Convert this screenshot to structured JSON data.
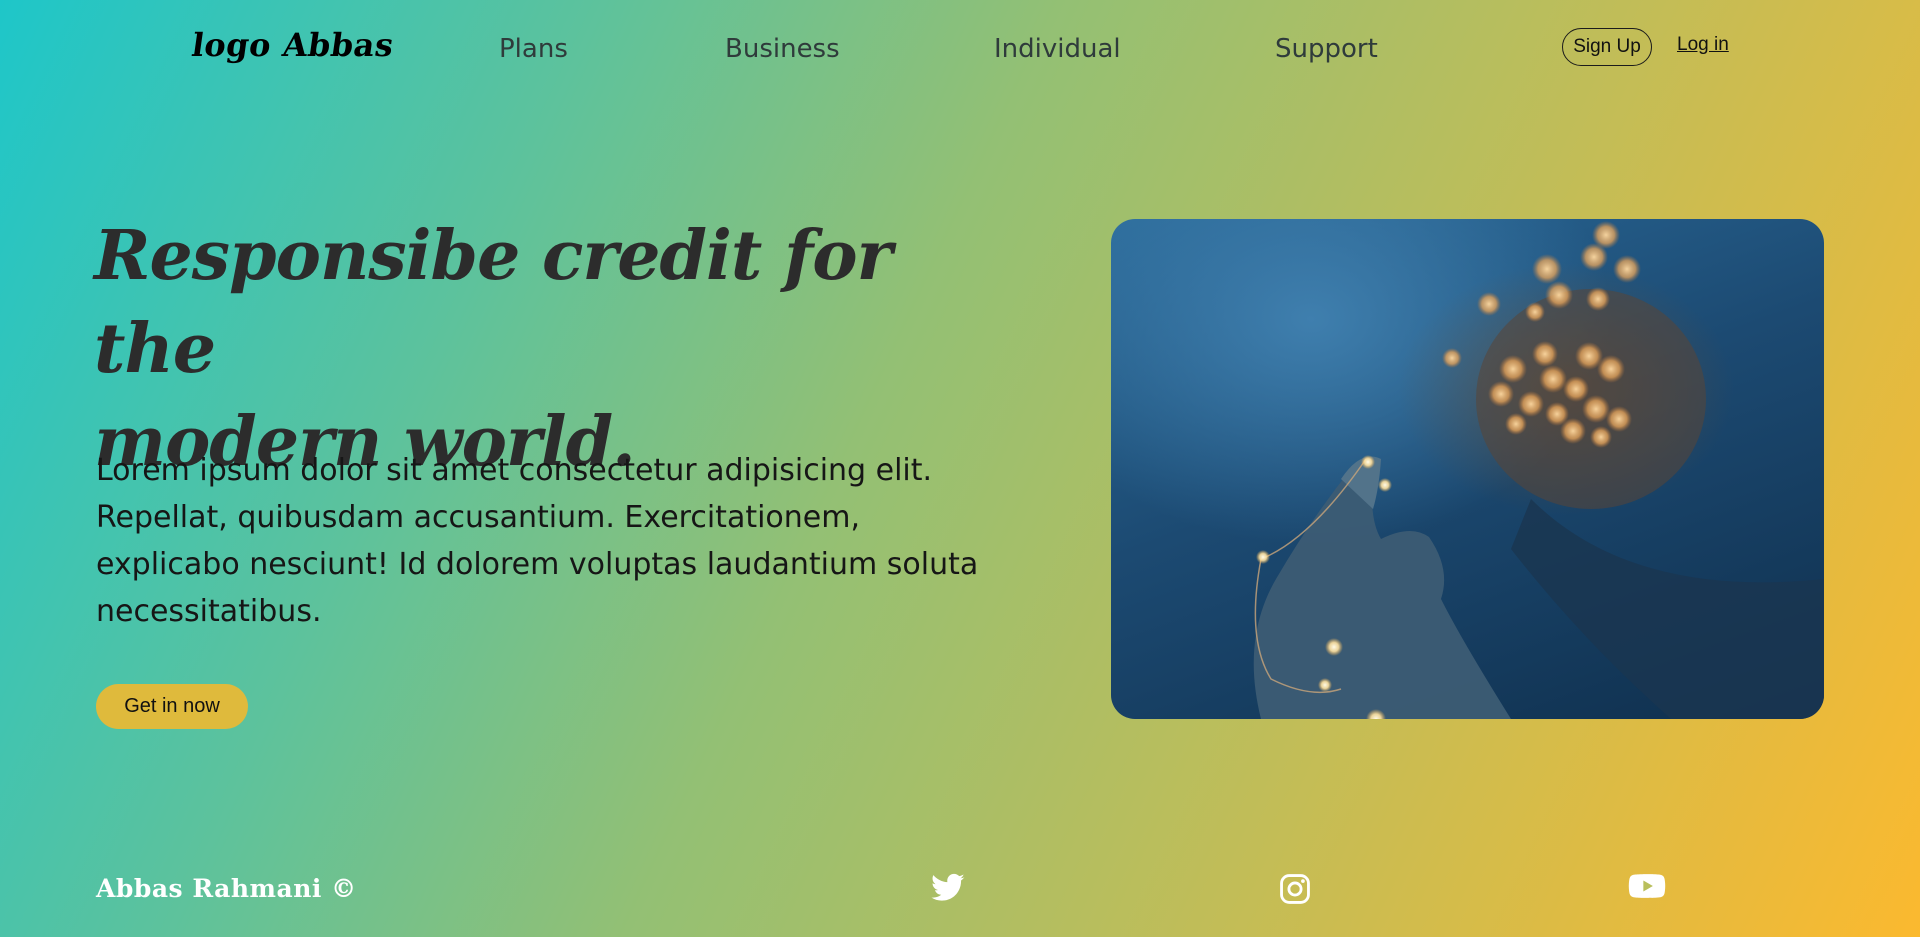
{
  "header": {
    "logo_text": "logo Abbas",
    "nav": [
      {
        "label": "Plans"
      },
      {
        "label": "Business"
      },
      {
        "label": "Individual"
      },
      {
        "label": "Support"
      }
    ],
    "signup_label": "Sign Up",
    "login_label": "Log in"
  },
  "hero": {
    "title_line1": "Responsibe credit for the",
    "title_line2": "modern world.",
    "paragraph_line1": "Lorem ipsum dolor sit amet consectetur adipisicing elit.",
    "paragraph_line2": "Repellat, quibusdam accusantium. Exercitationem,",
    "paragraph_line3": "explicabo nesciunt! Id dolorem voluptas laudantium soluta",
    "paragraph_line4": "necessitatibus.",
    "cta_label": "Get in now",
    "image_alt": "Hand holding string fairy lights"
  },
  "footer": {
    "copyright": "Abbas Rahmani ©",
    "social": [
      {
        "icon": "twitter-icon"
      },
      {
        "icon": "instagram-icon"
      },
      {
        "icon": "youtube-icon"
      }
    ]
  },
  "colors": {
    "gradient_start": "#1ec6c9",
    "gradient_end": "#fbb92f",
    "cta_bg": "#dfba3c",
    "title_color": "#2c2c2c"
  }
}
